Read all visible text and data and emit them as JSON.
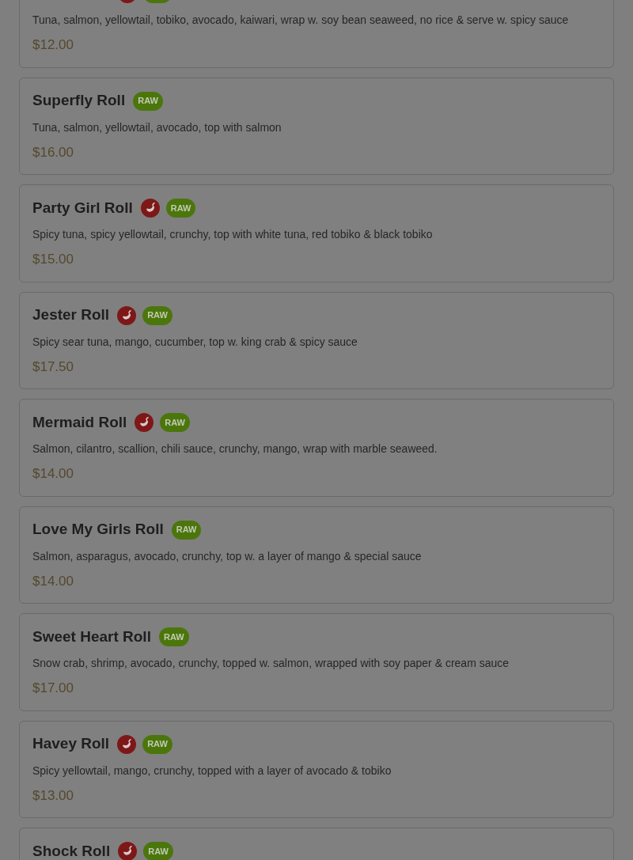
{
  "items": [
    {
      "spicy": true,
      "tags": [
        {
          "kind": "raw"
        }
      ],
      "description": "Tuna, salmon, yellowtail, tobiko, avocado, kaiwari, wrap w. soy bean seaweed, no rice & serve w. spicy sauce",
      "price": "$12.00"
    },
    {
      "name": "Superfly Roll",
      "spicy": false,
      "tags": [
        {
          "kind": "raw",
          "label": "RAW"
        }
      ],
      "description": "Tuna, salmon, yellowtail, avocado, top with salmon",
      "price": "$16.00"
    },
    {
      "name": "Party Girl Roll",
      "spicy": true,
      "tags": [
        {
          "kind": "raw",
          "label": "RAW"
        }
      ],
      "description": "Spicy tuna, spicy yellowtail, crunchy, top with white tuna, red tobiko & black tobiko",
      "price": "$15.00"
    },
    {
      "name": "Jester Roll",
      "spicy": true,
      "tags": [
        {
          "kind": "raw",
          "label": "RAW"
        }
      ],
      "description": "Spicy sear tuna, mango, cucumber, top w. king crab & spicy sauce",
      "price": "$17.50"
    },
    {
      "name": "Mermaid Roll",
      "spicy": true,
      "tags": [
        {
          "kind": "raw",
          "label": "RAW"
        }
      ],
      "description": "Salmon, cilantro, scallion, chili sauce, crunchy, mango, wrap with marble seaweed.",
      "price": "$14.00"
    },
    {
      "name": "Love My Girls Roll",
      "spicy": false,
      "tags": [
        {
          "kind": "raw",
          "label": "RAW"
        }
      ],
      "description": "Salmon, asparagus, avocado, crunchy, top w. a layer of mango & special sauce",
      "price": "$14.00"
    },
    {
      "name": "Sweet Heart Roll",
      "spicy": false,
      "tags": [
        {
          "kind": "raw",
          "label": "RAW"
        }
      ],
      "description": "Snow crab, shrimp, avocado, crunchy, topped w. salmon, wrapped with soy paper & cream sauce",
      "price": "$17.00"
    },
    {
      "name": "Havey Roll",
      "spicy": true,
      "tags": [
        {
          "kind": "raw",
          "label": "RAW"
        }
      ],
      "description": "Spicy yellowtail, mango, crunchy, topped with a layer of avocado & tobiko",
      "price": "$13.00"
    },
    {
      "name": "Shock Roll",
      "spicy": true,
      "tags": [
        {
          "kind": "raw",
          "label": "RAW"
        }
      ]
    }
  ]
}
